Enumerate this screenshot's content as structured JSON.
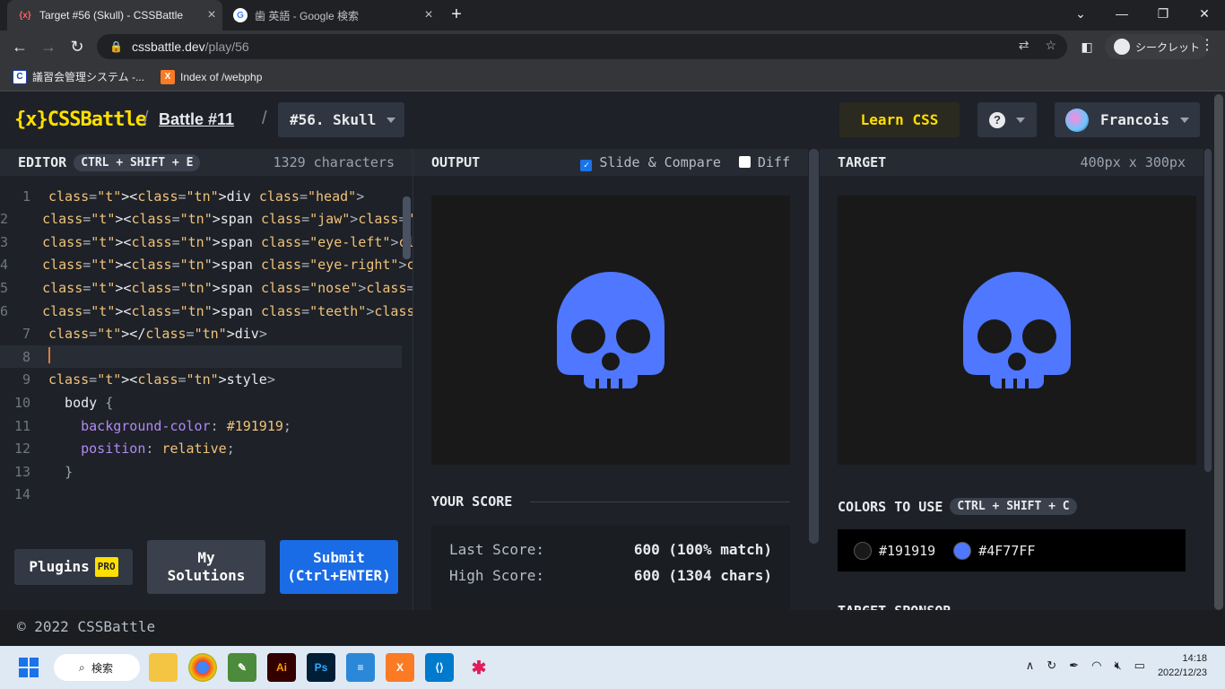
{
  "browser": {
    "tabs": [
      {
        "title": "Target #56 (Skull) - CSSBattle",
        "favicon": "{x}"
      },
      {
        "title": "歯 英語 - Google 検索",
        "favicon": "G"
      }
    ],
    "url_host": "cssbattle.dev",
    "url_path": "/play/56",
    "incognito_label": "シークレット",
    "bookmarks": [
      {
        "label": "議習会管理システム -...",
        "icon": "C"
      },
      {
        "label": "Index of /webphp",
        "icon": "X"
      }
    ]
  },
  "header": {
    "logo": "{x}CSSBattle",
    "battle": "Battle #11",
    "target_select": "#56. Skull",
    "learn": "Learn CSS",
    "help": "?",
    "user": "Francois"
  },
  "editor": {
    "title": "EDITOR",
    "shortcut": "CTRL + SHIFT + E",
    "chars": "1329 characters",
    "line_numbers": [
      "1",
      "2",
      "3",
      "4",
      "5",
      "6",
      "7",
      "8",
      "9",
      "10",
      "11",
      "12",
      "13",
      "14"
    ],
    "lines": [
      "<div class=\"head\">",
      "  <span class=\"jaw\"></span>",
      "  <span class=\"eye-left\"></span>",
      "  <span class=\"eye-right\"></span>",
      "  <span class=\"nose\"></span>",
      "  <span class=\"teeth\"></span>",
      "</div>",
      "",
      "<style>",
      "  body {",
      "    background-color: #191919;",
      "    position: relative;",
      "  }",
      ""
    ],
    "plugins": "Plugins",
    "pro": "PRO",
    "my_solutions": "My Solutions",
    "submit_line1": "Submit",
    "submit_line2": "(Ctrl+ENTER)"
  },
  "output": {
    "title": "OUTPUT",
    "slide_compare": "Slide & Compare",
    "slide_compare_checked": true,
    "diff": "Diff",
    "diff_checked": false
  },
  "score": {
    "title": "YOUR SCORE",
    "last_label": "Last Score:",
    "last_value": "600 (100% match)",
    "high_label": "High Score:",
    "high_value": "600 (1304 chars)"
  },
  "target": {
    "title": "TARGET",
    "size": "400px x 300px",
    "colors_title": "COLORS TO USE",
    "colors_shortcut": "CTRL + SHIFT + C",
    "colors": [
      {
        "hex": "#191919"
      },
      {
        "hex": "#4F77FF"
      }
    ],
    "sponsor": "TARGET SPONSOR"
  },
  "footer": {
    "copyright": "© 2022 CSSBattle"
  },
  "taskbar": {
    "search": "検索",
    "time": "14:18",
    "date": "2022/12/23"
  },
  "colors": {
    "accent_yellow": "#ffdf00",
    "skull_blue": "#4F77FF",
    "submit_blue": "#1a6be6"
  }
}
